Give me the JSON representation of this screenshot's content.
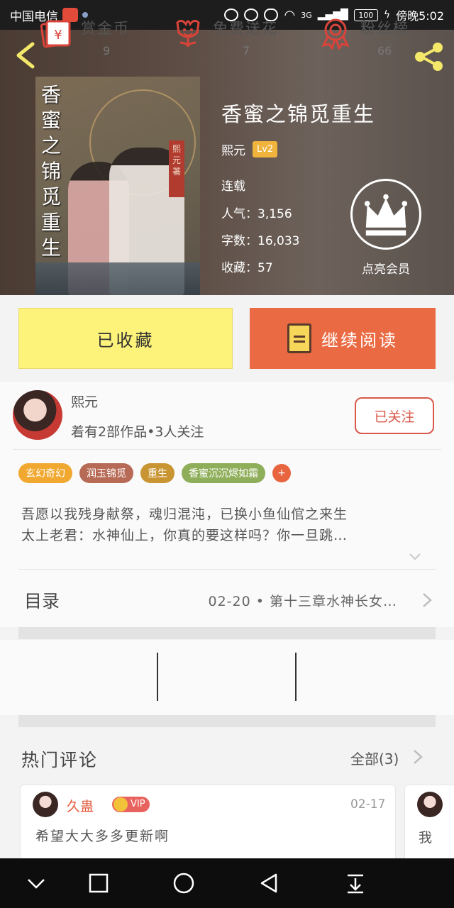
{
  "status_bar": {
    "carrier": "中国电信",
    "battery": "100",
    "network": "3G",
    "time": "傍晚5:02"
  },
  "book": {
    "title": "香蜜之锦觅重生",
    "author": "熙元",
    "level": "Lv2",
    "status": "连载",
    "popularity": "人气：3,156",
    "word_count": "字数：16,033",
    "favorites": "收藏：57",
    "cover_title": "香蜜之锦觅重生",
    "cover_author": "熙元著"
  },
  "vip": {
    "label": "点亮会员"
  },
  "actions": {
    "favorite": "已收藏",
    "continue_reading": "继续阅读"
  },
  "author_info": {
    "name": "熙元",
    "stats": "着有2部作品•3人关注",
    "follow": "已关注"
  },
  "tags": [
    {
      "label": "玄幻奇幻",
      "color": "#f0a830"
    },
    {
      "label": "润玉锦觅",
      "color": "#b76a55"
    },
    {
      "label": "重生",
      "color": "#c99532"
    },
    {
      "label": "香蜜沉沉烬如霜",
      "color": "#8fae5a"
    }
  ],
  "tag_more": "+",
  "synopsis": {
    "line1": "吾愿以我残身献祭，魂归混沌，已换小鱼仙倌之来生",
    "line2": "太上老君：水神仙上，你真的要这样吗？你一旦跳…"
  },
  "toc": {
    "label": "目录",
    "latest": "02-20 • 第十三章水神长女…"
  },
  "stats": {
    "reward": {
      "label": "赏金币",
      "value": "9"
    },
    "flower": {
      "label": "免费送花",
      "value": "7"
    },
    "fans": {
      "label": "粉丝榜",
      "value": "66"
    }
  },
  "hot_comments": {
    "title": "热门评论",
    "all": "全部(3)",
    "items": [
      {
        "name": "久蛊",
        "badge": "VIP",
        "date": "02-17",
        "text": "希望大大多多更新啊"
      },
      {
        "text": "我"
      }
    ]
  },
  "colors": {
    "accent_orange": "#ea6b43",
    "favorite_yellow": "#fdf27a",
    "follow_red": "#d9584a"
  }
}
